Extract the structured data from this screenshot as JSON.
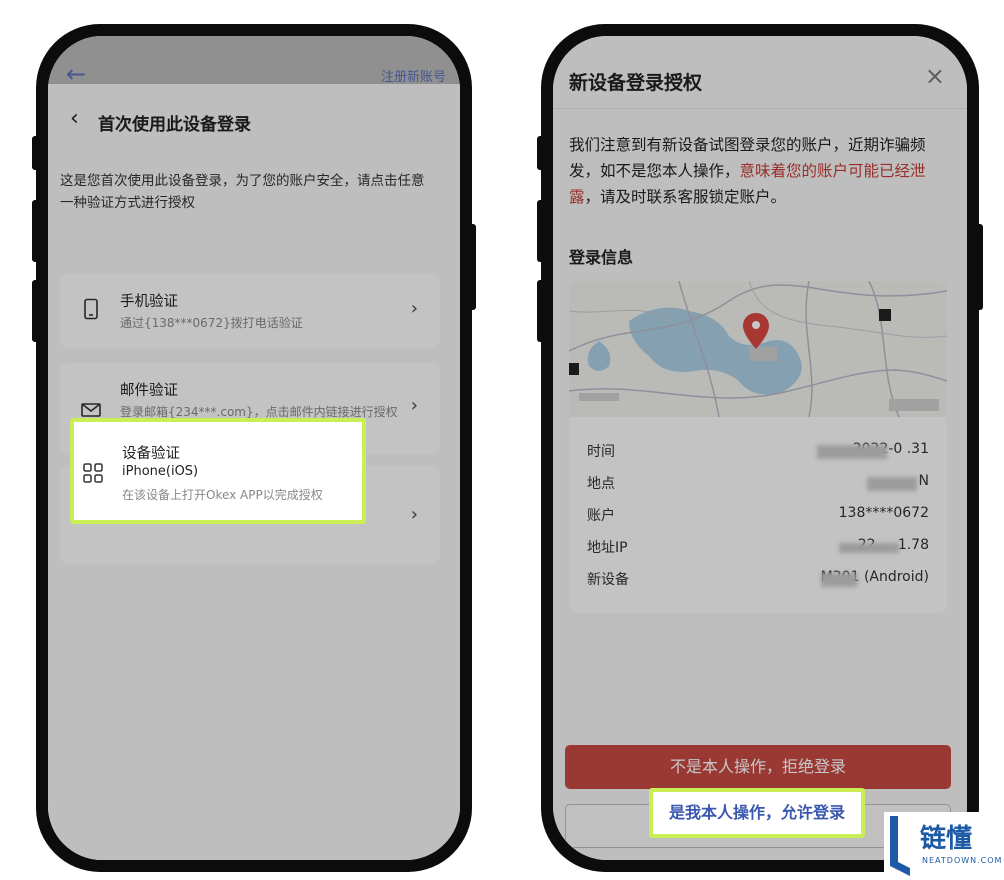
{
  "left": {
    "peek": {
      "back": "←",
      "register": "注册新账号"
    },
    "nav": {
      "back": "‹",
      "title": "首次使用此设备登录"
    },
    "intro": "这是您首次使用此设备登录，为了您的账户安全，请点击任意一种验证方式进行授权",
    "methods": [
      {
        "title": "手机验证",
        "sub": "通过{138***0672}拨打电话验证",
        "icon": "phone-icon"
      },
      {
        "title": "邮件验证",
        "sub": "登录邮箱{234***.com}，点击邮件内链接进行授权",
        "icon": "mail-icon"
      },
      {
        "title": "设备验证",
        "device": "iPhone(iOS)",
        "sub": "在该设备上打开Okex APP以完成授权",
        "icon": "grid-icon"
      }
    ],
    "chevron": "›"
  },
  "right": {
    "title": "新设备登录授权",
    "close": "×",
    "warn_pre": "我们注意到有新设备试图登录您的账户，近期诈骗频发，如不是您本人操作，",
    "warn_red": "意味着您的账户可能已经泄露",
    "warn_post": "，请及时联系客服锁定账户。",
    "info_heading": "登录信息",
    "rows": [
      {
        "key": "时间",
        "value": "2022-0      .31"
      },
      {
        "key": "地点",
        "value": "N"
      },
      {
        "key": "账户",
        "value": "138****0672"
      },
      {
        "key": "地址IP",
        "value": "22 .  .  1.78"
      },
      {
        "key": "新设备",
        "value": "M201  (Android)"
      }
    ],
    "reject": "不是本人操作，拒绝登录",
    "allow": "是我本人操作，允许登录"
  },
  "watermark": {
    "text": "链懂",
    "sub": "NEATDOWN.COM"
  },
  "colors": {
    "accent_red": "#c43c36",
    "reject_bg": "#c64a43",
    "highlight": "#c9ee56",
    "link_blue": "#3b58b0"
  }
}
